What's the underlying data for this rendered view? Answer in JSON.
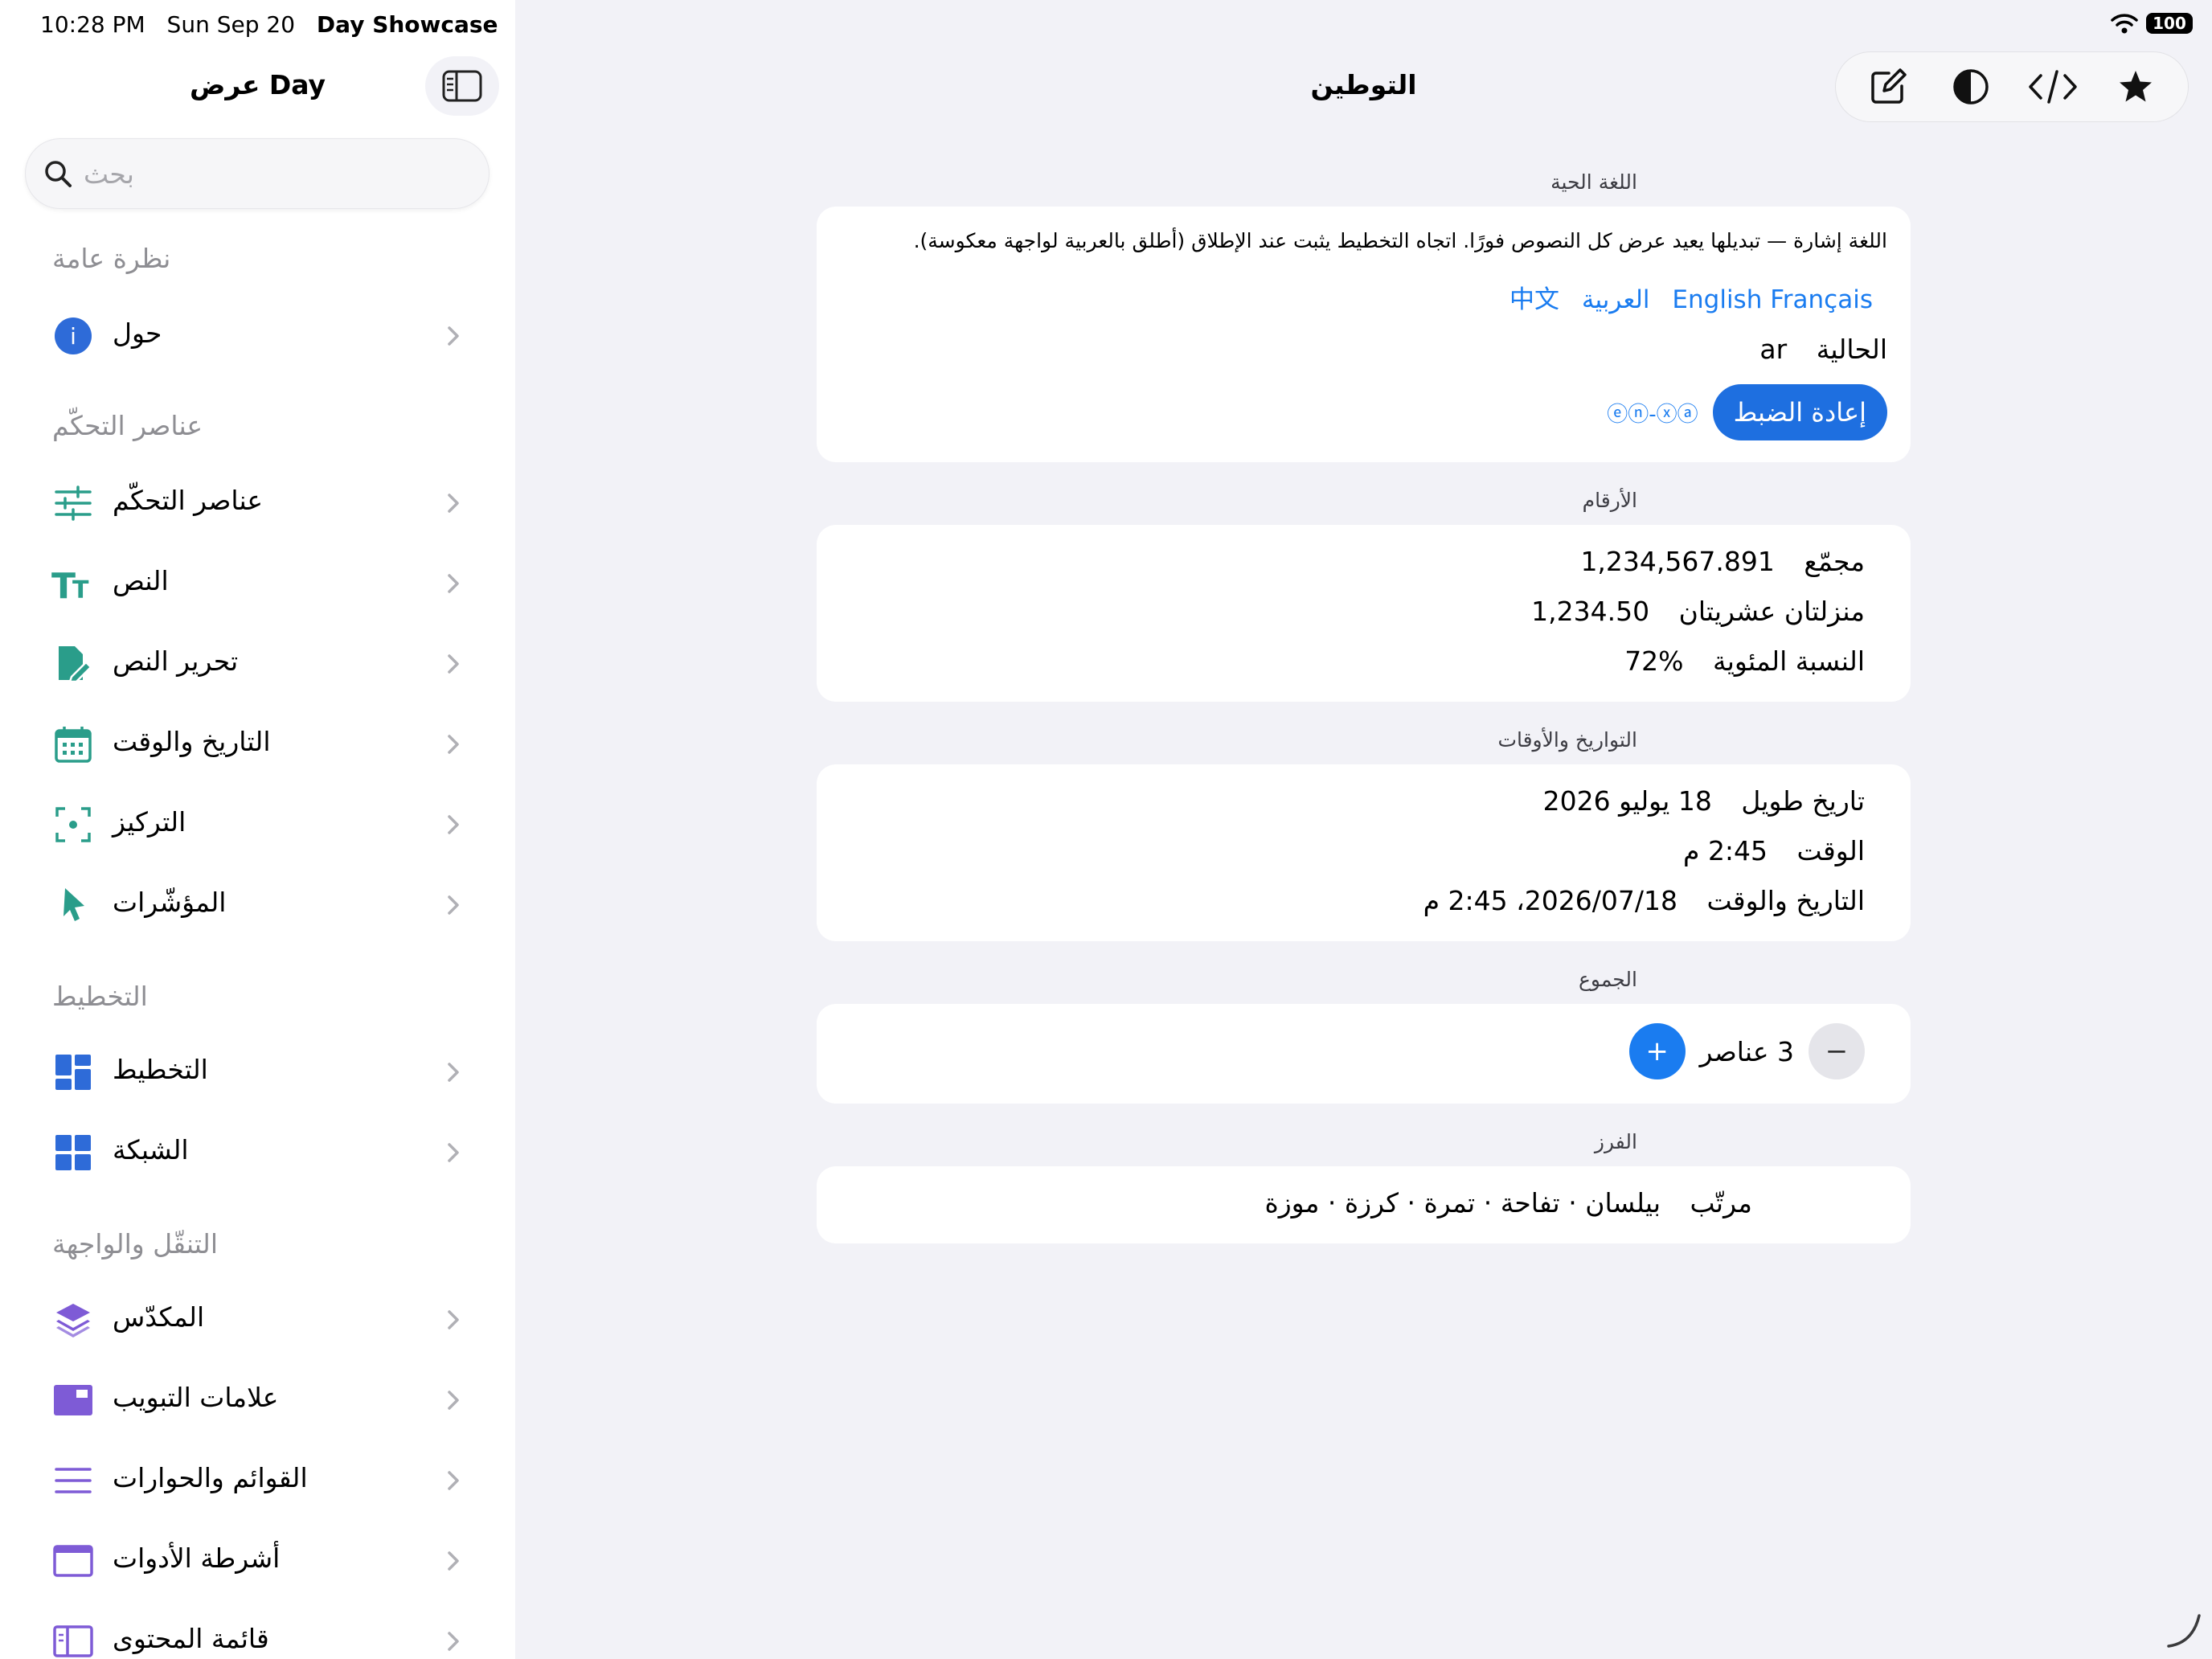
{
  "status": {
    "time": "10:28 PM",
    "date": "Sun Sep 20",
    "app": "Day Showcase",
    "battery": "100"
  },
  "sidebar": {
    "title": "عرض Day",
    "search_placeholder": "بحث",
    "sections": {
      "overview": "نظرة عامة",
      "controls": "عناصر التحكّم",
      "layout": "التخطيط",
      "navigation": "التنقّل والواجهة"
    },
    "items": {
      "about": "حول",
      "controls": "عناصر التحكّم",
      "text": "النص",
      "text_editing": "تحرير النص",
      "date_time": "التاريخ والوقت",
      "focus": "التركيز",
      "pointers": "المؤشّرات",
      "layout": "التخطيط",
      "grid": "الشبكة",
      "stack": "المكدّس",
      "tabs": "علامات التبويب",
      "lists": "القوائم والحوارات",
      "toolbars": "أشرطة الأدوات",
      "contents": "قائمة المحتوى"
    }
  },
  "main": {
    "title": "التوطين",
    "live_language": {
      "section": "اللغة الحية",
      "description": "اللغة إشارة — تبديلها يعيد عرض كل النصوص فورًا. اتجاه التخطيط يثبت عند الإطلاق (أطلق بالعربية لواجهة معكوسة).",
      "languages": [
        "English",
        "Français",
        "العربية",
        "中文"
      ],
      "current_label": "الحالية",
      "current_value": "ar",
      "reset_label": "إعادة الضبط",
      "pseudo_label": "ⓔⓝ-ⓧⓐ"
    },
    "numbers": {
      "section": "الأرقام",
      "rows": [
        {
          "label": "مجمّع",
          "value": "1,234,567.891"
        },
        {
          "label": "منزلتان عشريتان",
          "value": "1,234.50"
        },
        {
          "label": "النسبة المئوية",
          "value": "72%"
        }
      ]
    },
    "dates": {
      "section": "التواريخ والأوقات",
      "rows": [
        {
          "label": "تاريخ طويل",
          "value": "18 يوليو 2026"
        },
        {
          "label": "الوقت",
          "value": "2:45 م"
        },
        {
          "label": "التاريخ والوقت",
          "value": "2026/07/18، 2:45 م"
        }
      ]
    },
    "plurals": {
      "section": "الجموع",
      "count_text": "3 عناصر",
      "minus": "−",
      "plus": "+"
    },
    "sorting": {
      "section": "الفرز",
      "label": "مرتّب",
      "value": "بيلسان · تفاحة · تمرة · كرزة · موزة"
    }
  },
  "colors": {
    "accent": "#1e6fe0",
    "link": "#1a7cf0",
    "teal": "#2a9d8a",
    "purple": "#7e5bd6",
    "blue_icon": "#2e6bd8"
  }
}
